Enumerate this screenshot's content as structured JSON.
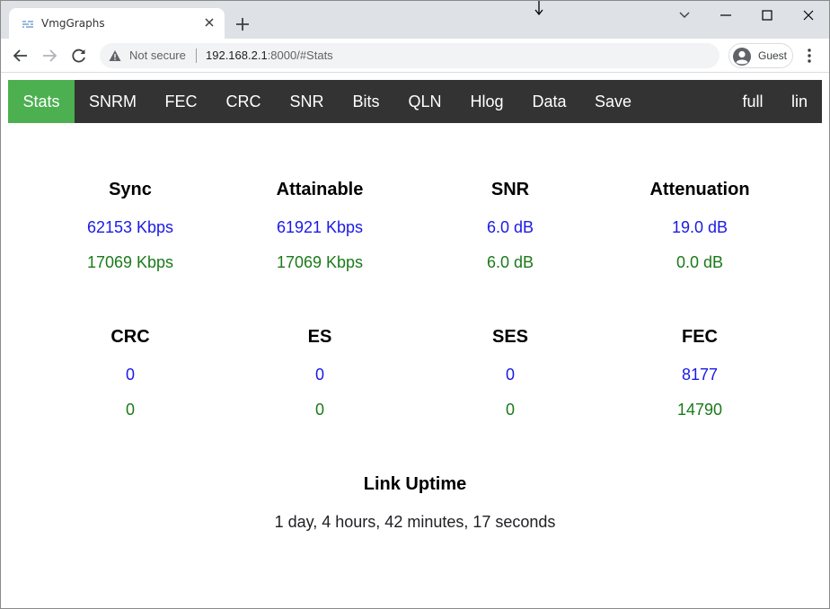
{
  "browser": {
    "tab_title": "VmgGraphs",
    "not_secure_label": "Not secure",
    "url_host": "192.168.2.1",
    "url_rest": ":8000/#Stats",
    "profile_label": "Guest"
  },
  "nav": {
    "items": [
      "Stats",
      "SNRM",
      "FEC",
      "CRC",
      "SNR",
      "Bits",
      "QLN",
      "Hlog",
      "Data",
      "Save"
    ],
    "right_items": [
      "full",
      "lin"
    ],
    "active": "Stats",
    "active_color": "#4caf50",
    "bar_color": "#333333"
  },
  "colors": {
    "downstream": "#1a1ae6",
    "upstream": "#1a7a1a"
  },
  "stats_row1": [
    {
      "label": "Sync",
      "down": "62153 Kbps",
      "up": "17069 Kbps"
    },
    {
      "label": "Attainable",
      "down": "61921 Kbps",
      "up": "17069 Kbps"
    },
    {
      "label": "SNR",
      "down": "6.0 dB",
      "up": "6.0 dB"
    },
    {
      "label": "Attenuation",
      "down": "19.0 dB",
      "up": "0.0 dB"
    }
  ],
  "stats_row2": [
    {
      "label": "CRC",
      "down": "0",
      "up": "0"
    },
    {
      "label": "ES",
      "down": "0",
      "up": "0"
    },
    {
      "label": "SES",
      "down": "0",
      "up": "0"
    },
    {
      "label": "FEC",
      "down": "8177",
      "up": "14790"
    }
  ],
  "uptime": {
    "label": "Link Uptime",
    "value": "1 day, 4 hours, 42 minutes, 17 seconds"
  },
  "icons": {
    "favicon": "chart-favicon-icon",
    "tab_close": "close-icon",
    "new_tab": "plus-icon",
    "minimize": "minimize-icon",
    "maximize": "maximize-icon",
    "close_window": "close-icon",
    "tab_search": "chevron-down-icon",
    "back": "back-arrow-icon",
    "forward": "forward-arrow-icon",
    "reload": "reload-icon",
    "warning": "warning-icon",
    "avatar": "avatar-icon",
    "menu": "kebab-menu-icon"
  }
}
